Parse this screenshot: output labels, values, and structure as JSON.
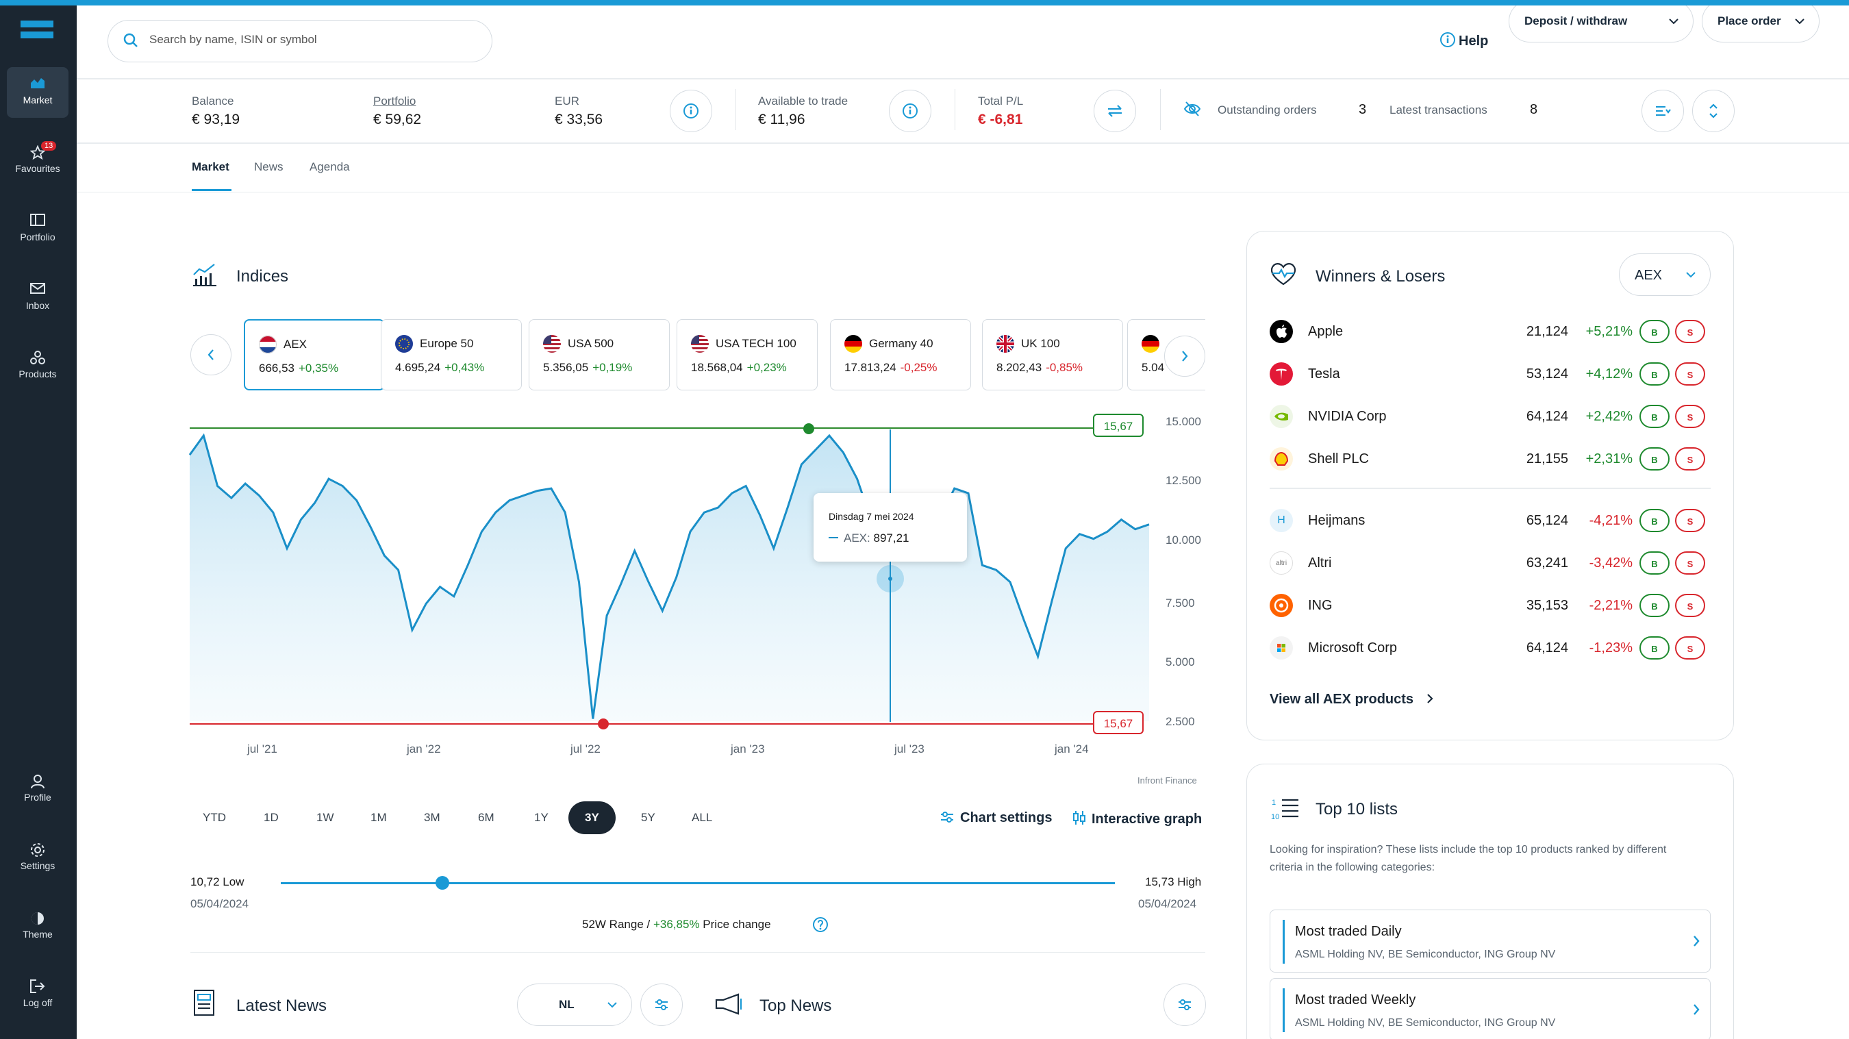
{
  "colors": {
    "accent": "#1a9ad6",
    "sidebar": "#1b2631",
    "positive": "#1e8a2e",
    "negative": "#d8262d"
  },
  "sidebar": {
    "items": [
      {
        "label": "Market",
        "icon": "market-icon"
      },
      {
        "label": "Favourites",
        "icon": "star-icon",
        "badge": "13"
      },
      {
        "label": "Portfolio",
        "icon": "portfolio-icon"
      },
      {
        "label": "Inbox",
        "icon": "inbox-icon"
      },
      {
        "label": "Products",
        "icon": "products-icon"
      },
      {
        "label": "Profile",
        "icon": "profile-icon"
      },
      {
        "label": "Settings",
        "icon": "gear-icon"
      },
      {
        "label": "Theme",
        "icon": "theme-icon"
      },
      {
        "label": "Log off",
        "icon": "logout-icon"
      }
    ]
  },
  "header": {
    "search_placeholder": "Search by name, ISIN or symbol",
    "help": "Help",
    "deposit": "Deposit / withdraw",
    "place_order": "Place order"
  },
  "account": {
    "balance_label": "Balance",
    "balance": "€ 93,19",
    "portfolio_label": "Portfolio",
    "portfolio": "€ 59,62",
    "eur_label": "EUR",
    "eur": "€ 33,56",
    "available_label": "Available to trade",
    "available": "€ 11,96",
    "pl_label": "Total P/L",
    "pl": "€ -6,81",
    "outstanding_label": "Outstanding orders",
    "outstanding": "3",
    "latest_label": "Latest transactions",
    "latest": "8"
  },
  "tabs": [
    "Market",
    "News",
    "Agenda"
  ],
  "indices": {
    "title": "Indices",
    "cards": [
      {
        "name": "AEX",
        "value": "666,53",
        "change": "+0,35%",
        "dir": "pos",
        "flag": "nl"
      },
      {
        "name": "Europe 50",
        "value": "4.695,24",
        "change": "+0,43%",
        "dir": "pos",
        "flag": "eu"
      },
      {
        "name": "USA 500",
        "value": "5.356,05",
        "change": "+0,19%",
        "dir": "pos",
        "flag": "us"
      },
      {
        "name": "USA TECH 100",
        "value": "18.568,04",
        "change": "+0,23%",
        "dir": "pos",
        "flag": "us"
      },
      {
        "name": "Germany 40",
        "value": "17.813,24",
        "change": "-0,25%",
        "dir": "neg",
        "flag": "de"
      },
      {
        "name": "UK 100",
        "value": "8.202,43",
        "change": "-0,85%",
        "dir": "neg",
        "flag": "uk"
      },
      {
        "name": "",
        "value": "5.04",
        "change": "",
        "dir": "pos",
        "flag": "de"
      }
    ]
  },
  "chart_data": {
    "type": "area",
    "series": [
      {
        "name": "AEX",
        "values": [
          13600,
          14400,
          12300,
          11800,
          12400,
          11900,
          11200,
          9700,
          10900,
          11600,
          12600,
          12300,
          11700,
          10600,
          9400,
          8800,
          6300,
          7400,
          8100,
          7700,
          9000,
          10400,
          11200,
          11700,
          11900,
          12100,
          12200,
          11200,
          8300,
          2600,
          6900,
          8200,
          9600,
          8300,
          7100,
          8500,
          10400,
          11200,
          11400,
          12000,
          12300,
          11100,
          9700,
          11400,
          13200,
          13800,
          14400,
          13700,
          12600,
          10900,
          9800,
          11700,
          11300,
          10600,
          11000,
          12200,
          12000,
          9000,
          8800,
          8300,
          6700,
          5200,
          7500,
          9700,
          10300,
          10100,
          10400,
          10900,
          10500,
          10700
        ]
      }
    ],
    "x_ticks": [
      "jul '21",
      "jan '22",
      "jul '22",
      "jan '23",
      "jul '23",
      "jan '24"
    ],
    "y_ticks": [
      "15.000",
      "12.500",
      "10.000",
      "7.500",
      "5.000",
      "2.500"
    ],
    "ylim": [
      2500,
      15000
    ],
    "high_marker": "15,67",
    "low_marker": "15,67",
    "tooltip": {
      "date": "Dinsdag 7 mei 2024",
      "series": "AEX:",
      "value": "897,21"
    },
    "source": "Infront Finance"
  },
  "periods": [
    "YTD",
    "1D",
    "1W",
    "1M",
    "3M",
    "6M",
    "1Y",
    "3Y",
    "5Y",
    "ALL"
  ],
  "chart_settings": "Chart settings",
  "interactive_graph": "Interactive graph",
  "range": {
    "low": "10,72 Low",
    "low_date": "05/04/2024",
    "high": "15,73 High",
    "high_date": "05/04/2024",
    "label": "52W Range /",
    "change": "+36,85%",
    "change_label": "Price change",
    "position": 0.22
  },
  "latest_news": {
    "title": "Latest News",
    "lang": "NL"
  },
  "top_news": {
    "title": "Top News"
  },
  "winners": {
    "title": "Winners & Losers",
    "index": "AEX",
    "rows": [
      {
        "name": "Apple",
        "price": "21,124",
        "pct": "+5,21%",
        "dir": "pos"
      },
      {
        "name": "Tesla",
        "price": "53,124",
        "pct": "+4,12%",
        "dir": "pos"
      },
      {
        "name": "NVIDIA Corp",
        "price": "64,124",
        "pct": "+2,42%",
        "dir": "pos"
      },
      {
        "name": "Shell PLC",
        "price": "21,155",
        "pct": "+2,31%",
        "dir": "pos"
      },
      {
        "name": "Heijmans",
        "price": "65,124",
        "pct": "-4,21%",
        "dir": "neg"
      },
      {
        "name": "Altri",
        "price": "63,241",
        "pct": "-3,42%",
        "dir": "neg"
      },
      {
        "name": "ING",
        "price": "35,153",
        "pct": "-2,21%",
        "dir": "neg"
      },
      {
        "name": "Microsoft Corp",
        "price": "64,124",
        "pct": "-1,23%",
        "dir": "neg"
      }
    ],
    "buy": "B",
    "sell": "S",
    "view_all": "View all AEX products"
  },
  "top10": {
    "title": "Top 10 lists",
    "desc": "Looking for inspiration? These lists include the top 10 products ranked by different criteria in the following categories:",
    "items": [
      {
        "title": "Most traded Daily",
        "sub": "ASML Holding NV, BE Semiconductor, ING Group NV"
      },
      {
        "title": "Most traded Weekly",
        "sub": "ASML Holding NV, BE Semiconductor, ING Group NV"
      }
    ]
  }
}
